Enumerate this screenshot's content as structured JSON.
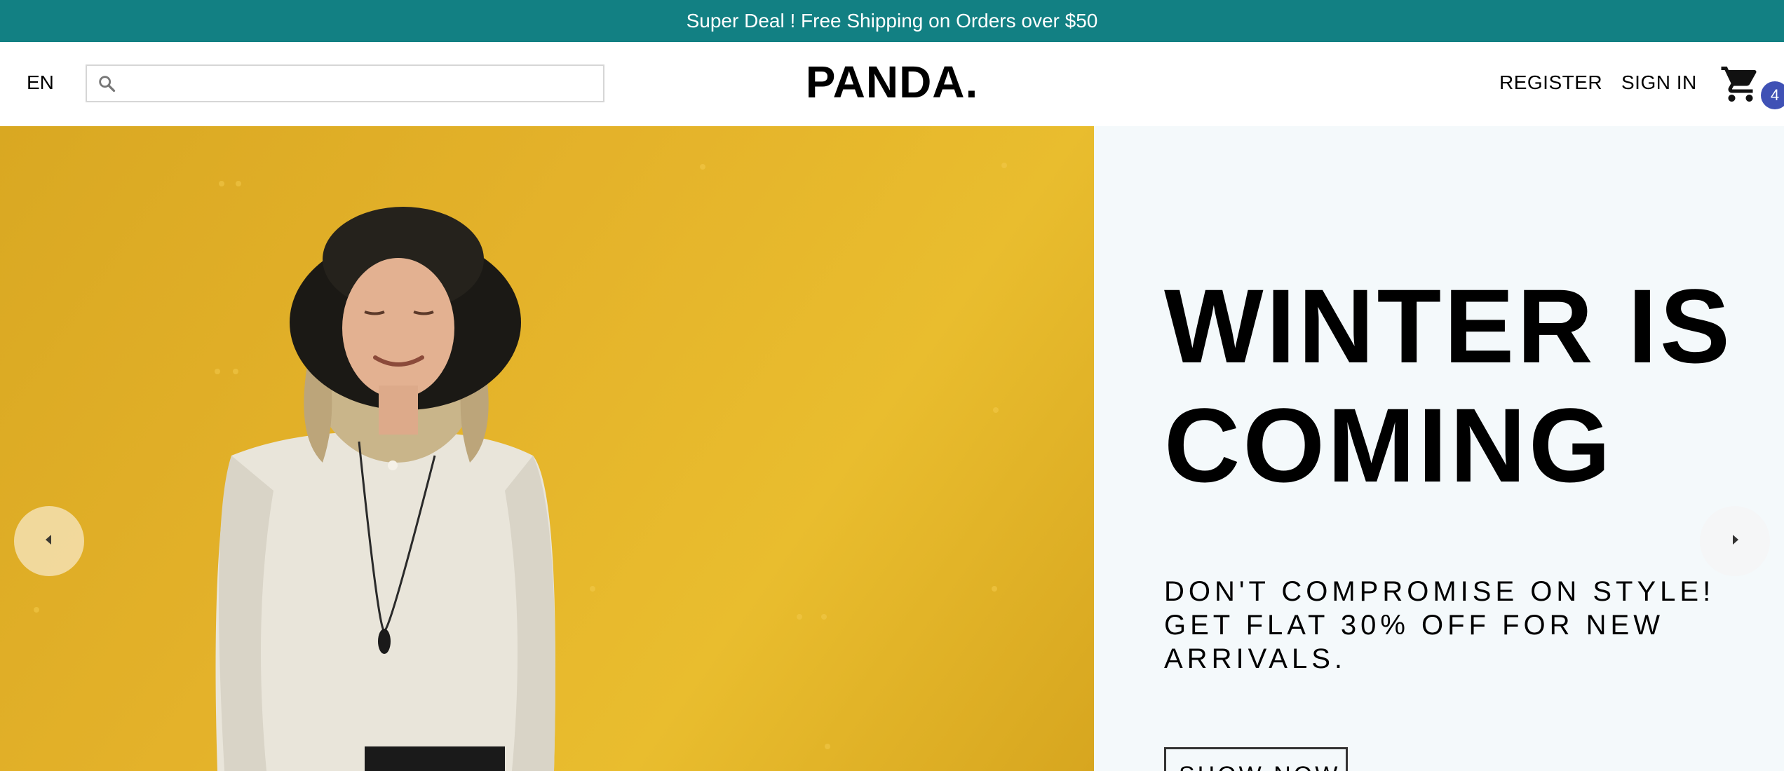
{
  "announcement": {
    "text": "Super Deal ! Free Shipping on Orders over $50"
  },
  "navbar": {
    "language": "EN",
    "search_placeholder": "",
    "logo": "PANDA.",
    "register_label": "REGISTER",
    "signin_label": "SIGN IN",
    "cart_count": "4",
    "cart_icon": "shopping-cart-icon",
    "search_icon": "search-icon"
  },
  "hero": {
    "title": "WINTER IS COMING",
    "description": "DON'T COMPROMISE ON STYLE! GET FLAT 30% OFF FOR NEW ARRIVALS.",
    "button_label": "SHOW NOW",
    "image_alt": "woman-in-black-hat-yellow-background",
    "left_arrow_icon": "arrow-left-icon",
    "right_arrow_icon": "arrow-right-icon"
  },
  "colors": {
    "announcement_bg": "#128083",
    "badge_bg": "#3f51b5",
    "hero_image_bg": "#e2b02a",
    "hero_info_bg": "#f4f9fb"
  }
}
